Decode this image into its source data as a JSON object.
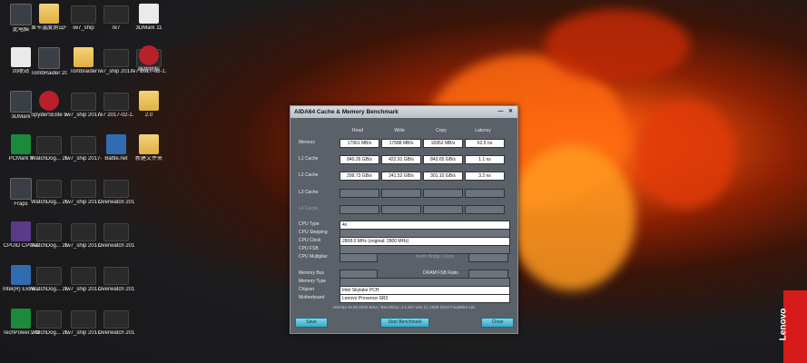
{
  "desktop_icons": [
    {
      "label": "此电脑",
      "style": "app"
    },
    {
      "label": "显卡温度测试FurMark_1",
      "style": "folder"
    },
    {
      "label": "iw7_ship",
      "style": "wide"
    },
    {
      "label": "re7",
      "style": "wide"
    },
    {
      "label": "3DMark 11",
      "style": "white"
    },
    {
      "label": "回收站",
      "style": "white"
    },
    {
      "label": "TombRaider 2017-02-1...",
      "style": "app"
    },
    {
      "label": "Tombraider",
      "style": "folder"
    },
    {
      "label": "iw7_ship 2017-02-1...",
      "style": "wide"
    },
    {
      "label": "re7 2017-02-1...",
      "style": "wide"
    },
    {
      "label": "联想特权",
      "style": "red"
    },
    {
      "label": "3DMark",
      "style": "app"
    },
    {
      "label": "SpyderSElite 5.0",
      "style": "red"
    },
    {
      "label": "iw7_ship 2017-02-1...",
      "style": "wide"
    },
    {
      "label": "re7 2017-02-1...",
      "style": "wide"
    },
    {
      "label": "2.0",
      "style": "folder"
    },
    {
      "label": "PCMark 8",
      "style": "green"
    },
    {
      "label": "WatchDog... 2017-02-1...",
      "style": "wide"
    },
    {
      "label": "iw7_ship 2017-02-1...",
      "style": "wide"
    },
    {
      "label": "Battle.net",
      "style": "blue"
    },
    {
      "label": "新建文件夹",
      "style": "folder"
    },
    {
      "label": "Fraps",
      "style": "app"
    },
    {
      "label": "WatchDog... 2017-02-1...",
      "style": "wide"
    },
    {
      "label": "iw7_ship 2017-02-1...",
      "style": "wide"
    },
    {
      "label": "Overwatch 2017-02-1...",
      "style": "wide"
    },
    {
      "label": "CPUID CPU-Z",
      "style": "purple"
    },
    {
      "label": "WatchDog... 2017-02-1...",
      "style": "wide"
    },
    {
      "label": "iw7_ship 2017-02-1...",
      "style": "wide"
    },
    {
      "label": "Overwatch 2017-02-1...",
      "style": "wide"
    },
    {
      "label": "Intel(R) Extre...",
      "style": "blue"
    },
    {
      "label": "WatchDog... 2017-02-1...",
      "style": "wide"
    },
    {
      "label": "iw7_ship 2017-02-1...",
      "style": "wide"
    },
    {
      "label": "Overwatch 2017-02-1...",
      "style": "wide"
    },
    {
      "label": "TechPower... GPU-Z",
      "style": "green"
    },
    {
      "label": "WatchDog... 2017-02-1...",
      "style": "wide"
    },
    {
      "label": "iw7_ship 2017-02-1...",
      "style": "wide"
    },
    {
      "label": "Overwatch 2017-02-1...",
      "style": "wide"
    }
  ],
  "window": {
    "title": "AIDA64 Cache & Memory Benchmark",
    "min_glyph": "—",
    "close_glyph": "✕",
    "columns": [
      "Read",
      "Write",
      "Copy",
      "Latency"
    ],
    "rows": [
      {
        "label": "Memory",
        "values": [
          "17961 MB/s",
          "17588 MB/s",
          "16952 MB/s",
          "62.5 ns"
        ]
      },
      {
        "label": "L1 Cache",
        "values": [
          "840.26 GB/s",
          "422.91 GB/s",
          "843.65 GB/s",
          "1.1 ns"
        ]
      },
      {
        "label": "L2 Cache",
        "values": [
          "299.73 GB/s",
          "241.52 GB/s",
          "301.10 GB/s",
          "3.2 ns"
        ]
      },
      {
        "label": "L3 Cache",
        "values": [
          "",
          "",
          "",
          ""
        ]
      },
      {
        "label": "L4 Cache",
        "values": [
          "",
          "",
          "",
          ""
        ]
      }
    ],
    "cpu_type_label": "CPU Type",
    "cpu_type": "4x",
    "cpu_stepping_label": "CPU Stepping",
    "cpu_stepping": "",
    "cpu_clock_label": "CPU Clock",
    "cpu_clock": "2808.0 MHz  (original: 2800 MHz)",
    "cpu_fsb_label": "CPU FSB",
    "cpu_fsb": "",
    "cpu_multiplier_label": "CPU Multiplier",
    "cpu_multiplier": "",
    "north_bridge_label": "North Bridge Clock",
    "north_bridge": "",
    "memory_bus_label": "Memory Bus",
    "memory_bus": "",
    "dram_fsb_label": "DRAM:FSB Ratio",
    "dram_fsb": "",
    "memory_type_label": "Memory Type",
    "memory_type": "",
    "chipset_label": "Chipset",
    "chipset": "Intel Skylake PCH",
    "motherboard_label": "Motherboard",
    "motherboard": "Lenovo Provence-SR3",
    "footer": "AIDA64 v5.00.3300 Beta / BenchDLL 4.1.627-x64  (c) 1995-2014 FinalWire Ltd.",
    "save_label": "Save",
    "start_label": "Start Benchmark",
    "close_label": "Close"
  },
  "brand_text": "Lenovo",
  "colors": {
    "window_bg": "#5b6168",
    "button": "#3aa9c4",
    "brand": "#d51a1a"
  }
}
